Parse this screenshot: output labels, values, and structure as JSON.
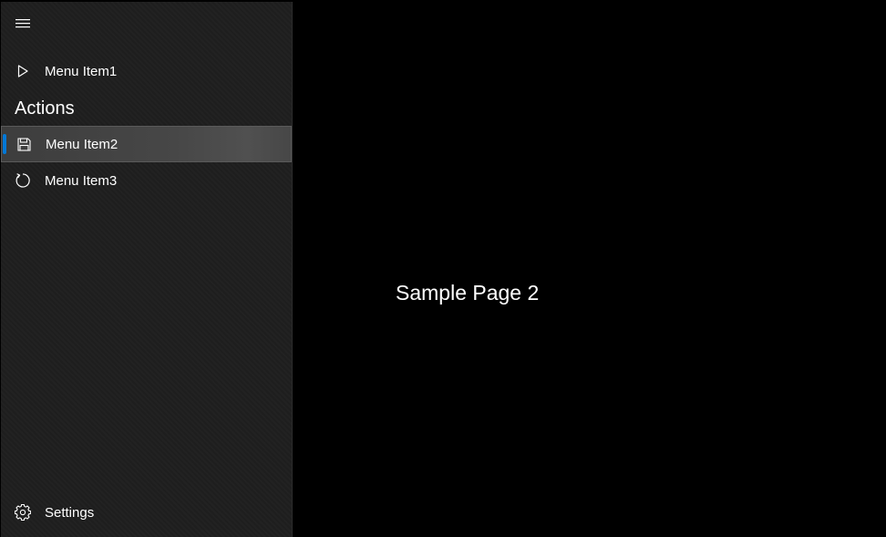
{
  "nav": {
    "toggle_icon": "hamburger-menu-icon",
    "items": [
      {
        "label": "Menu Item1",
        "icon": "play-icon"
      },
      {
        "label": "Menu Item2",
        "icon": "save-icon",
        "selected": true
      },
      {
        "label": "Menu Item3",
        "icon": "refresh-icon"
      }
    ],
    "section_header": "Actions",
    "settings": {
      "label": "Settings",
      "icon": "gear-icon"
    }
  },
  "content": {
    "text": "Sample Page 2"
  },
  "colors": {
    "accent": "#0078d7",
    "pane_background": "#1f1f1f",
    "content_background": "#000000",
    "text": "#ffffff"
  }
}
